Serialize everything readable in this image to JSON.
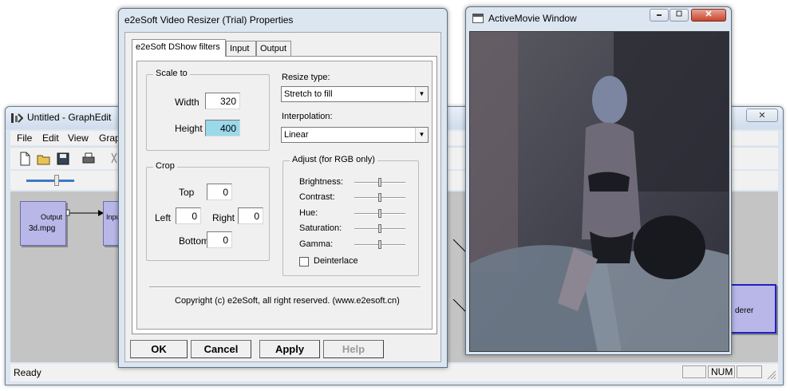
{
  "graphedit": {
    "title": "Untitled - GraphEdit",
    "close_label": "✕",
    "menu": [
      "File",
      "Edit",
      "View",
      "Grap"
    ],
    "filters": {
      "source_pin": "Output",
      "source_name": "3d.mpg",
      "next_pin": "Input",
      "renderer_text": "derer"
    },
    "status": "Ready",
    "indicators": [
      "",
      "NUM",
      ""
    ]
  },
  "dialog": {
    "title": "e2eSoft Video Resizer (Trial) Properties",
    "tabs": [
      "e2eSoft DShow filters",
      "Input",
      "Output"
    ],
    "scale": {
      "label": "Scale to",
      "width_label": "Width",
      "width_value": "320",
      "height_label": "Height",
      "height_value": "400"
    },
    "crop": {
      "label": "Crop",
      "top_label": "Top",
      "top_value": "0",
      "left_label": "Left",
      "left_value": "0",
      "right_label": "Right",
      "right_value": "0",
      "bottom_label": "Bottom",
      "bottom_value": "0"
    },
    "resize_type": {
      "label": "Resize type:",
      "value": "Stretch to fill"
    },
    "interpolation": {
      "label": "Interpolation:",
      "value": "Linear"
    },
    "adjust": {
      "label": "Adjust (for RGB only)",
      "brightness": "Brightness:",
      "contrast": "Contrast:",
      "hue": "Hue:",
      "saturation": "Saturation:",
      "gamma": "Gamma:",
      "levels": [
        0.5,
        0.5,
        0.5,
        0.5,
        0.5
      ],
      "deinterlace_label": "Deinterlace",
      "deinterlace_checked": false
    },
    "copyright": "Copyright (c) e2eSoft, all right reserved. (www.e2esoft.cn)",
    "buttons": {
      "ok": "OK",
      "cancel": "Cancel",
      "apply": "Apply",
      "help": "Help"
    }
  },
  "activemovie": {
    "title": "ActiveMovie Window"
  },
  "colors": {
    "field_selected": "#99d9ea",
    "filter_box": "#b8b7e8",
    "canvas": "#c4c4c4"
  }
}
